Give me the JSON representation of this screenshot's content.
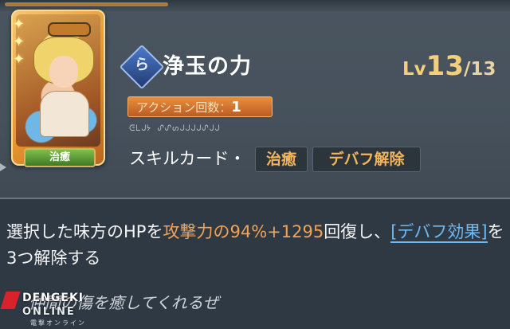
{
  "card": {
    "role_label": "治癒",
    "star_icon": "star-icon",
    "star_count": 3
  },
  "skill": {
    "name": "浄玉の力",
    "icon": "skill-symbol-icon",
    "level_label": "Lv",
    "level": "13",
    "level_max": "13",
    "action_label": "アクション回数：",
    "action_count": "1",
    "glyph_text": "ᕮᒪᒍᔭ ᔑᔑᔕᒍᒍᒍᒍᔑᒍᒍ",
    "card_type_label": "スキルカード・",
    "tags": [
      "治癒",
      "デバフ解除"
    ]
  },
  "description": {
    "part1": "選択した味方のHPを",
    "highlight": "攻撃力の94%+1295",
    "part2": "回復し、",
    "link": "[デバフ効果]",
    "part3": "を3つ解除する"
  },
  "flavor": "仲間の傷を癒してくれるぜ",
  "watermark": {
    "line1": "DENGEKI",
    "line2": "ONLINE",
    "line3": "電撃オンライン"
  },
  "colors": {
    "accent_orange": "#f2a257",
    "link_blue": "#6fb9f3",
    "level_gold": "#f3cf7a"
  }
}
